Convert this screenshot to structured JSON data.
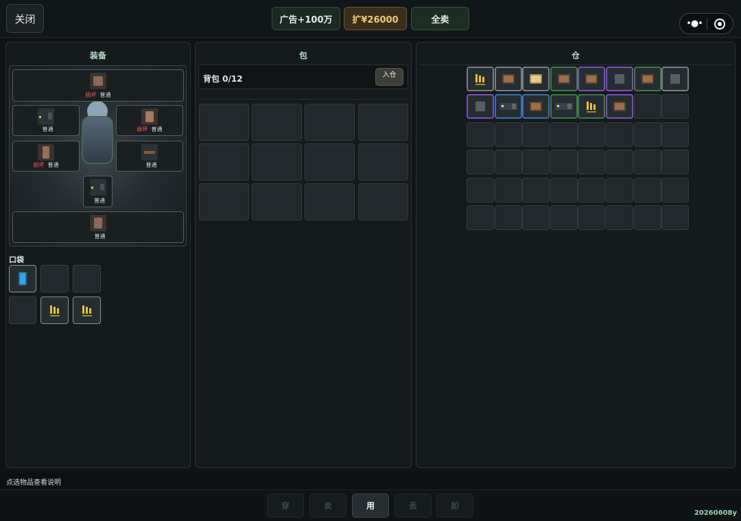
{
  "top": {
    "close_label": "关闭",
    "ad_label": "广告+100万",
    "expand_label": "扩¥26000",
    "sell_all_label": "全卖",
    "more_glyph": "•●•"
  },
  "equipment": {
    "title": "装备",
    "slots": [
      {
        "damaged": "损坏",
        "quality": "普通",
        "icon": "backpack-icon"
      },
      {
        "damaged": "",
        "quality": "普通",
        "icon": "rifle-icon"
      },
      {
        "damaged": "损坏",
        "quality": "普通",
        "icon": "armor-icon"
      },
      {
        "damaged": "损坏",
        "quality": "普通",
        "icon": "vest-icon"
      },
      {
        "damaged": "",
        "quality": "普通",
        "icon": "melee-icon"
      },
      {
        "damaged": "",
        "quality": "普通",
        "icon": "pistol-icon"
      },
      {
        "damaged": "",
        "quality": "普通",
        "icon": "chest-rig-icon"
      }
    ],
    "pocket_title": "口袋",
    "pockets": [
      {
        "item": "phone-icon"
      },
      {
        "item": ""
      },
      {
        "item": ""
      },
      {
        "item": ""
      },
      {
        "item": "ammo-icon"
      },
      {
        "item": "ammo-icon"
      }
    ]
  },
  "bag": {
    "title": "包",
    "label": "背包 0/12",
    "store_label": "入仓"
  },
  "warehouse": {
    "title": "仓",
    "items_row1": [
      {
        "icon": "ammo-icon",
        "rarity": "common"
      },
      {
        "icon": "box-icon",
        "rarity": "common"
      },
      {
        "icon": "box-light-icon",
        "rarity": "common"
      },
      {
        "icon": "box-icon",
        "rarity": "green"
      },
      {
        "icon": "box-icon",
        "rarity": "purple"
      },
      {
        "icon": "gray-block-icon",
        "rarity": "purple"
      },
      {
        "icon": "box-icon",
        "rarity": "green"
      },
      {
        "icon": "gray-block-icon",
        "rarity": "common"
      }
    ],
    "items_row2": [
      {
        "icon": "gray-block-icon",
        "rarity": "purple"
      },
      {
        "icon": "gun-icon",
        "rarity": "blue"
      },
      {
        "icon": "box-icon",
        "rarity": "blue"
      },
      {
        "icon": "gun-icon",
        "rarity": "green"
      },
      {
        "icon": "ammo-icon",
        "rarity": "green"
      },
      {
        "icon": "box-icon",
        "rarity": "purple"
      }
    ]
  },
  "status_text": "点选物品查看说明",
  "actions": [
    "穿",
    "卖",
    "用",
    "丢",
    "卸"
  ],
  "active_action": "用",
  "version": "20260608y",
  "colors": {
    "rarity_green": "#3d7a47",
    "rarity_purple": "#7b4ec2",
    "rarity_blue": "#3a6fb4",
    "damaged_red": "#ff5757",
    "gold_text": "#f0c978",
    "title_green": "#b7dcc4"
  }
}
